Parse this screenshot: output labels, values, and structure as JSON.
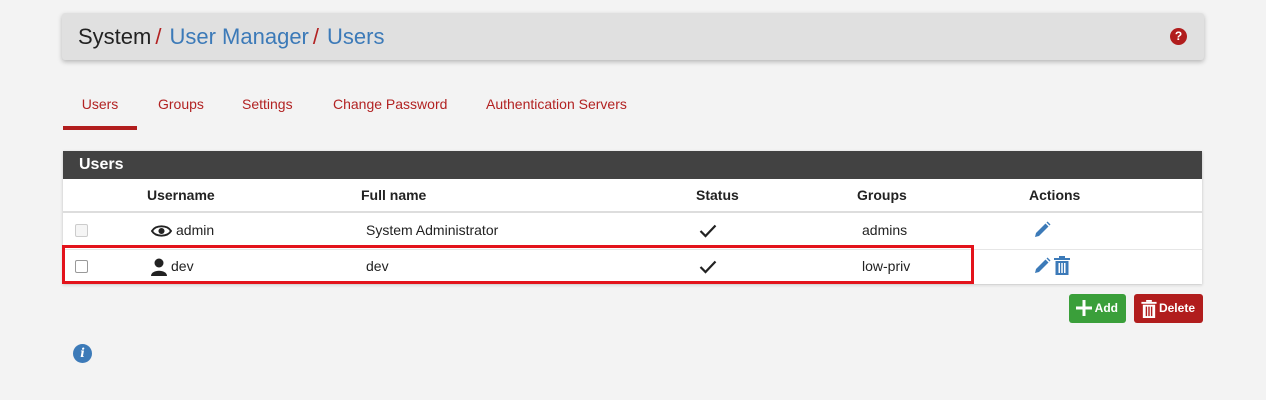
{
  "breadcrumb": {
    "root": "System",
    "sep": "/",
    "items": [
      "User Manager",
      "Users"
    ]
  },
  "header": {
    "help_icon": "question-circle-icon",
    "help_glyph": "?"
  },
  "tabs": [
    {
      "label": "Users",
      "active": true
    },
    {
      "label": "Groups",
      "active": false
    },
    {
      "label": "Settings",
      "active": false
    },
    {
      "label": "Change Password",
      "active": false
    },
    {
      "label": "Authentication Servers",
      "active": false
    }
  ],
  "panel": {
    "title": "Users"
  },
  "table": {
    "columns": [
      "Username",
      "Full name",
      "Status",
      "Groups",
      "Actions"
    ],
    "rows": [
      {
        "username": "admin",
        "user_icon": "eye-icon",
        "fullname": "System Administrator",
        "status": "✓",
        "groups": "admins",
        "checkbox_disabled": true,
        "actions": [
          "edit-icon"
        ]
      },
      {
        "username": "dev",
        "user_icon": "user-icon",
        "fullname": "dev",
        "status": "✓",
        "groups": "low-priv",
        "checkbox_disabled": false,
        "actions": [
          "edit-icon",
          "trash-icon"
        ]
      }
    ]
  },
  "buttons": {
    "add_label": "Add",
    "delete_label": "Delete"
  },
  "info_glyph": "i",
  "colors": {
    "accent_red": "#b11d1d",
    "link_blue": "#3c7ab8",
    "add_green": "#3a9f3a",
    "panel_heading": "#424242",
    "highlight": "#e3131b"
  }
}
